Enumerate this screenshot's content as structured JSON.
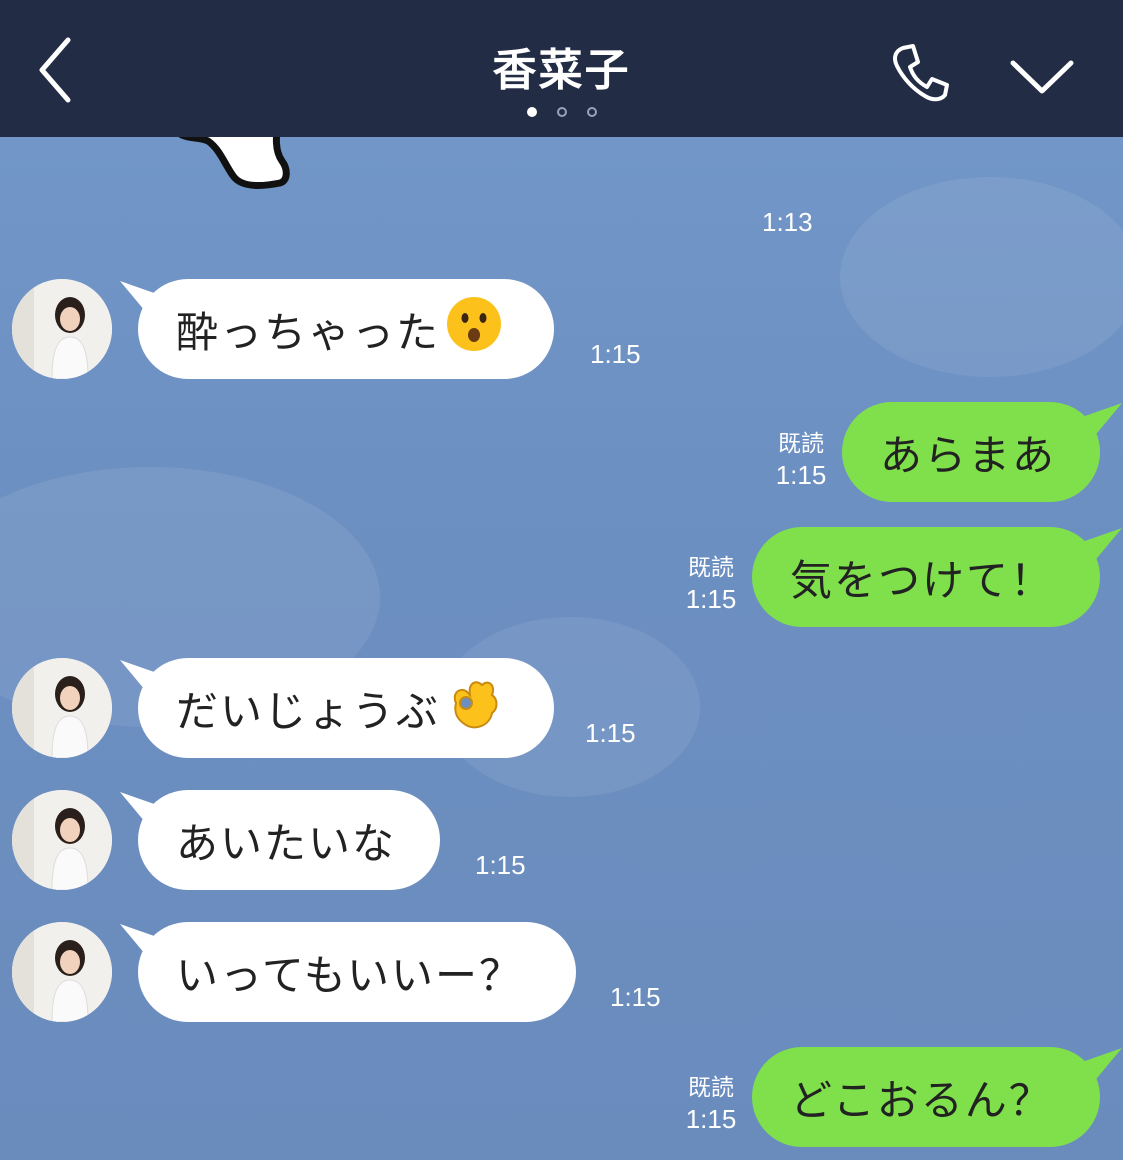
{
  "header": {
    "title": "香菜子",
    "page_dots": 3,
    "active_dot": 0,
    "back_icon": "chevron-left-icon",
    "call_icon": "phone-icon",
    "menu_icon": "chevron-down-icon",
    "bg_color": "#222c44"
  },
  "chat": {
    "bg_color": "#6c8fc1",
    "sticker_time": "1:13",
    "messages": [
      {
        "side": "in",
        "text": "酔っちゃった",
        "emoji": "hushed-face-emoji",
        "time": "1:15"
      },
      {
        "side": "out",
        "text": "あらまあ",
        "read": "既読",
        "time": "1:15"
      },
      {
        "side": "out",
        "text": "気をつけて！",
        "read": "既読",
        "time": "1:15"
      },
      {
        "side": "in",
        "text": "だいじょうぶ",
        "emoji": "ok-hand-emoji",
        "time": "1:15"
      },
      {
        "side": "in",
        "text": "あいたいな",
        "time": "1:15"
      },
      {
        "side": "in",
        "text": "いってもいいー？",
        "time": "1:15"
      },
      {
        "side": "out",
        "text": "どこおるん？",
        "read": "既読",
        "time": "1:15"
      }
    ]
  },
  "colors": {
    "incoming_bubble": "#ffffff",
    "outgoing_bubble": "#7fe04b"
  }
}
